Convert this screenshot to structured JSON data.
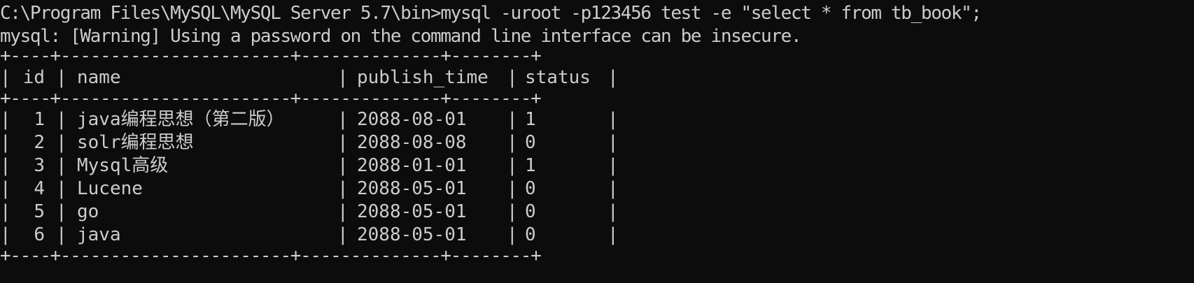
{
  "terminal": {
    "command_line": "C:\\Program Files\\MySQL\\MySQL Server 5.7\\bin>mysql -uroot -p123456 test -e \"select * from tb_book\";",
    "warning_line": "mysql: [Warning] Using a password on the command line interface can be insecure.",
    "separator": "+----+-----------------------+--------------+--------+"
  },
  "table": {
    "headers": [
      "id",
      "name",
      "publish_time",
      "status"
    ],
    "rows": [
      [
        "1",
        "java编程思想（第二版）",
        "2088-08-01",
        "1"
      ],
      [
        "2",
        "solr编程思想",
        "2088-08-08",
        "0"
      ],
      [
        "3",
        "Mysql高级",
        "2088-01-01",
        "1"
      ],
      [
        "4",
        "Lucene",
        "2088-05-01",
        "0"
      ],
      [
        "5",
        "go",
        "2088-05-01",
        "0"
      ],
      [
        "6",
        "java",
        "2088-05-01",
        "0"
      ]
    ]
  },
  "colors": {
    "background": "#0c0c0c",
    "foreground": "#cccccc"
  }
}
